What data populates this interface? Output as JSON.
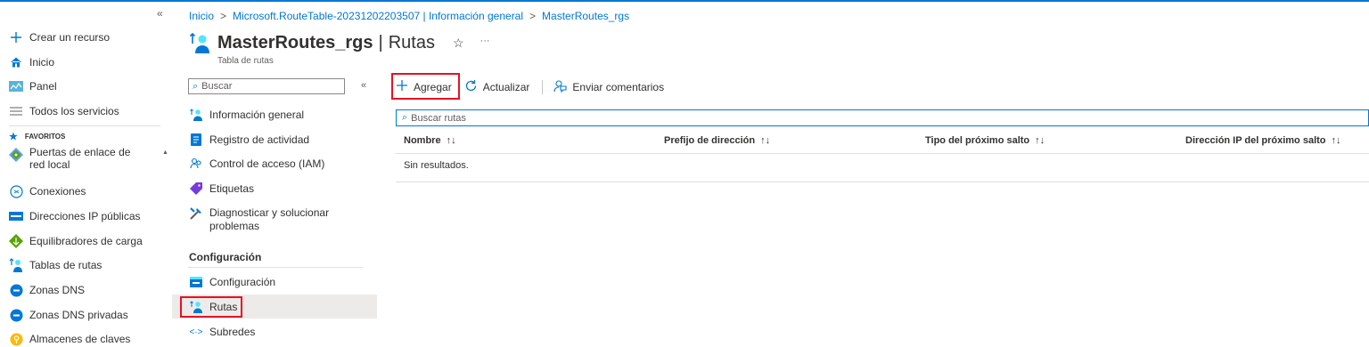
{
  "colors": {
    "accent": "#0078d4",
    "highlight": "#e81123"
  },
  "leftnav": {
    "collapse_glyph": "«",
    "items": [
      {
        "label": "Crear un recurso",
        "icon": "plus-icon"
      },
      {
        "label": "Inicio",
        "icon": "home-icon"
      },
      {
        "label": "Panel",
        "icon": "dashboard-icon"
      },
      {
        "label": "Todos los servicios",
        "icon": "list-icon"
      }
    ],
    "favorites_label": "FAVORITOS",
    "favorites": [
      {
        "label": "Puertas de enlace de red local",
        "icon": "local-gateway-icon"
      },
      {
        "label": "Conexiones",
        "icon": "connections-icon"
      },
      {
        "label": "Direcciones IP públicas",
        "icon": "public-ip-icon"
      },
      {
        "label": "Equilibradores de carga",
        "icon": "load-balancer-icon"
      },
      {
        "label": "Tablas de rutas",
        "icon": "route-table-icon"
      },
      {
        "label": "Zonas DNS",
        "icon": "dns-zone-icon"
      },
      {
        "label": "Zonas DNS privadas",
        "icon": "private-dns-icon"
      },
      {
        "label": "Almacenes de claves",
        "icon": "key-vault-icon"
      }
    ]
  },
  "breadcrumb": {
    "items": [
      "Inicio",
      "Microsoft.RouteTable-20231202203507 | Información general",
      "MasterRoutes_rgs"
    ],
    "separator": ">"
  },
  "header": {
    "resource_name": "MasterRoutes_rgs",
    "pipe": "|",
    "section": "Rutas",
    "subtitle": "Tabla de rutas",
    "star_glyph": "☆",
    "more_glyph": "···"
  },
  "resmenu": {
    "search_placeholder": "Buscar",
    "collapse_glyph": "«",
    "items": [
      {
        "label": "Información general",
        "icon": "overview-icon"
      },
      {
        "label": "Registro de actividad",
        "icon": "activity-log-icon"
      },
      {
        "label": "Control de acceso (IAM)",
        "icon": "iam-icon"
      },
      {
        "label": "Etiquetas",
        "icon": "tag-icon"
      },
      {
        "label": "Diagnosticar y solucionar problemas",
        "icon": "diagnose-icon"
      }
    ],
    "section_label": "Configuración",
    "section_items": [
      {
        "label": "Configuración",
        "icon": "configuration-icon"
      },
      {
        "label": "Rutas",
        "icon": "routes-icon",
        "active": true
      },
      {
        "label": "Subredes",
        "icon": "subnets-icon"
      }
    ]
  },
  "commandbar": {
    "add_label": "Agregar",
    "refresh_label": "Actualizar",
    "feedback_label": "Enviar comentarios"
  },
  "table": {
    "search_placeholder": "Buscar rutas",
    "sort_glyph": "↑↓",
    "columns": [
      "Nombre",
      "Prefijo de dirección",
      "Tipo del próximo salto",
      "Dirección IP del próximo salto"
    ],
    "empty_text": "Sin resultados."
  }
}
